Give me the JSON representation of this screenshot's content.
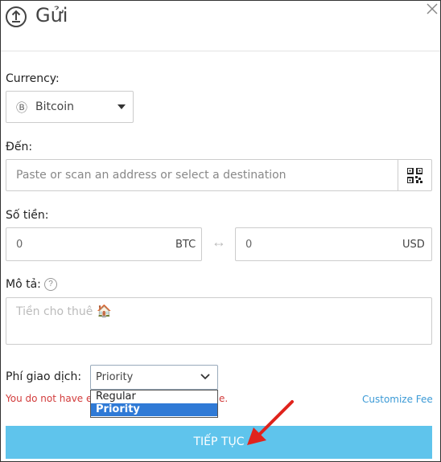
{
  "header": {
    "title": "Gửi"
  },
  "currency": {
    "label": "Currency:",
    "value": "Bitcoin",
    "coin_glyph": "Ⓑ"
  },
  "to": {
    "label": "Đến:",
    "placeholder": "Paste or scan an address or select a destination"
  },
  "amount": {
    "label": "Số tiền:",
    "btc_value": "0",
    "btc_unit": "BTC",
    "usd_value": "0",
    "usd_unit": "USD",
    "swap_glyph": "↔"
  },
  "description": {
    "label": "Mô tả:",
    "help_glyph": "?",
    "placeholder": "Tiền cho thuê",
    "emoji": "🏠"
  },
  "fee": {
    "label": "Phí giao dịch:",
    "selected": "Priority",
    "options": [
      "Regular",
      "Priority"
    ],
    "error": "You do not have e",
    "error_tail": "e.",
    "customize_link": "Customize Fee"
  },
  "submit": {
    "label": "TIẾP TỤC"
  },
  "colors": {
    "button": "#5fc4ec",
    "link": "#3b9ad6",
    "error": "#d23b3b",
    "selected_option": "#2f7ad6",
    "arrow": "#e0231c"
  }
}
